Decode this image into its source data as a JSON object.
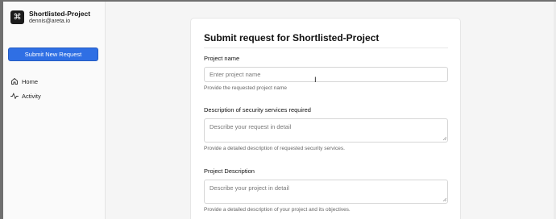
{
  "sidebar": {
    "logo_glyph": "⌘",
    "project_name": "Shortlisted-Project",
    "user_email": "dennis@areta.io",
    "submit_button": "Submit New Request",
    "nav": [
      {
        "label": "Home",
        "icon": "home-icon"
      },
      {
        "label": "Activity",
        "icon": "activity-icon"
      }
    ]
  },
  "form": {
    "title": "Submit request for Shortlisted-Project",
    "fields": [
      {
        "label": "Project name",
        "placeholder": "Enter project name",
        "hint": "Provide the requested project name"
      },
      {
        "label": "Description of security services required",
        "placeholder": "Describe your request in detail",
        "hint": "Provide a detailed description of requested security services."
      },
      {
        "label": "Project Description",
        "placeholder": "Describe your project in detail",
        "hint": "Provide a detailed description of your project and its objectives."
      }
    ]
  },
  "colors": {
    "primary": "#2f6fe4",
    "sidebar_bg": "#fafafa",
    "page_bg": "#f5f5f5"
  }
}
